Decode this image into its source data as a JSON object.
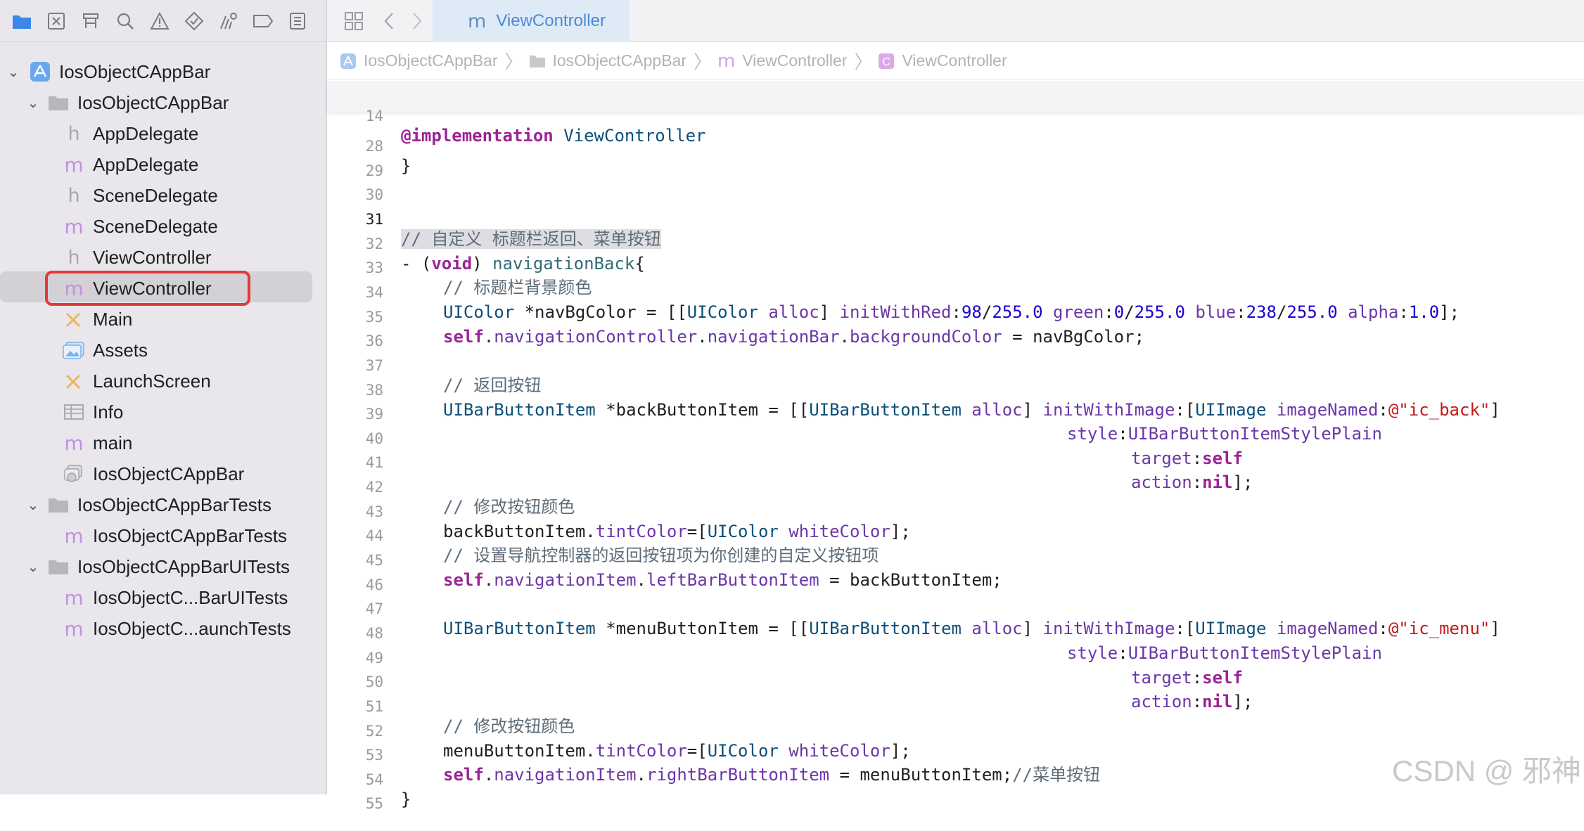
{
  "navigator": {
    "toolbar_icons": [
      "folder-icon",
      "source-control-icon",
      "symbol-icon",
      "find-icon",
      "issue-icon",
      "test-icon",
      "debug-icon",
      "breakpoint-icon",
      "report-icon"
    ],
    "items": [
      {
        "label": "IosObjectCAppBar",
        "icon": "project-icon",
        "level": 0,
        "disclosure": "open"
      },
      {
        "label": "IosObjectCAppBar",
        "icon": "folder-icon",
        "level": 1,
        "disclosure": "open"
      },
      {
        "label": "AppDelegate",
        "icon": "h-file-icon",
        "level": 2
      },
      {
        "label": "AppDelegate",
        "icon": "m-file-icon",
        "level": 2
      },
      {
        "label": "SceneDelegate",
        "icon": "h-file-icon",
        "level": 2
      },
      {
        "label": "SceneDelegate",
        "icon": "m-file-icon",
        "level": 2
      },
      {
        "label": "ViewController",
        "icon": "h-file-icon",
        "level": 2
      },
      {
        "label": "ViewController",
        "icon": "m-file-icon",
        "level": 2,
        "selected": true
      },
      {
        "label": "Main",
        "icon": "storyboard-icon",
        "level": 2
      },
      {
        "label": "Assets",
        "icon": "assets-icon",
        "level": 2
      },
      {
        "label": "LaunchScreen",
        "icon": "storyboard-icon",
        "level": 2
      },
      {
        "label": "Info",
        "icon": "plist-icon",
        "level": 2
      },
      {
        "label": "main",
        "icon": "m-file-icon",
        "level": 2
      },
      {
        "label": "IosObjectCAppBar",
        "icon": "entitlements-icon",
        "level": 2
      },
      {
        "label": "IosObjectCAppBarTests",
        "icon": "folder-icon",
        "level": 1,
        "disclosure": "open"
      },
      {
        "label": "IosObjectCAppBarTests",
        "icon": "m-file-icon",
        "level": 2
      },
      {
        "label": "IosObjectCAppBarUITests",
        "icon": "folder-icon",
        "level": 1,
        "disclosure": "open"
      },
      {
        "label": "IosObjectC...BarUITests",
        "icon": "m-file-icon",
        "level": 2
      },
      {
        "label": "IosObjectC...aunchTests",
        "icon": "m-file-icon",
        "level": 2
      }
    ]
  },
  "tab": {
    "icon": "m",
    "label": "ViewController"
  },
  "breadcrumb": [
    {
      "label": "IosObjectCAppBar",
      "icon": "project-icon"
    },
    {
      "label": "IosObjectCAppBar",
      "icon": "folder-icon"
    },
    {
      "label": "ViewController",
      "icon": "m-file-icon"
    },
    {
      "label": "ViewController",
      "icon": "class-icon"
    }
  ],
  "sticky_header": {
    "line": "14",
    "keyword": "@implementation",
    "name": "ViewController"
  },
  "code": {
    "l28": {
      "n": "28",
      "t": "}"
    },
    "l29": {
      "n": "29"
    },
    "l30": {
      "n": "30"
    },
    "l31": {
      "n": "31",
      "comment": "// 自定义 标题栏返回、菜单按钮"
    },
    "l32": {
      "n": "32",
      "a": "- (",
      "kw": "void",
      "b": ") ",
      "fn": "navigationBack",
      "c": "{"
    },
    "l33": {
      "n": "33",
      "comment": "// 标题栏背景颜色"
    },
    "l34": {
      "n": "34",
      "cls": "UIColor",
      "a": " *navBgColor = [[",
      "cls2": "UIColor",
      "m1": " alloc",
      "b": "] ",
      "m2": "initWithRed",
      "c": ":",
      "n1": "98",
      "d": "/",
      "n2": "255.0",
      "m3": " green",
      "e": ":",
      "n3": "0",
      "f": "/",
      "n4": "255.0",
      "m4": " blue",
      "g": ":",
      "n5": "238",
      "h": "/",
      "n6": "255.0",
      "m5": " alpha",
      "i": ":",
      "n7": "1.0",
      "j": "];"
    },
    "l35": {
      "n": "35",
      "kw": "self",
      "a": ".",
      "p1": "navigationController",
      "b": ".",
      "p2": "navigationBar",
      "c": ".",
      "p3": "backgroundColor",
      "d": " = navBgColor;"
    },
    "l36": {
      "n": "36"
    },
    "l37": {
      "n": "37",
      "comment": "// 返回按钮"
    },
    "l38": {
      "n": "38",
      "cls": "UIBarButtonItem",
      "a": " *backButtonItem = [[",
      "cls2": "UIBarButtonItem",
      "m1": " alloc",
      "b": "] ",
      "m2": "initWithImage",
      "c": ":[",
      "cls3": "UIImage",
      "m3": " imageNamed",
      "d": ":",
      "str": "@\"ic_back\"",
      "e": "]"
    },
    "l39": {
      "n": "39",
      "m": "style",
      "a": ":",
      "v": "UIBarButtonItemStylePlain"
    },
    "l40": {
      "n": "40",
      "m": "target",
      "a": ":",
      "kw": "self"
    },
    "l41": {
      "n": "41",
      "m": "action",
      "a": ":",
      "kw": "nil",
      "b": "];"
    },
    "l42": {
      "n": "42",
      "comment": "// 修改按钮颜色"
    },
    "l43": {
      "n": "43",
      "a": "backButtonItem.",
      "p": "tintColor",
      "b": "=[",
      "cls": "UIColor",
      "m": " whiteColor",
      "c": "];"
    },
    "l44": {
      "n": "44",
      "comment": "// 设置导航控制器的返回按钮项为你创建的自定义按钮项"
    },
    "l45": {
      "n": "45",
      "kw": "self",
      "a": ".",
      "p1": "navigationItem",
      "b": ".",
      "p2": "leftBarButtonItem",
      "c": " = backButtonItem;"
    },
    "l46": {
      "n": "46"
    },
    "l47": {
      "n": "47",
      "cls": "UIBarButtonItem",
      "a": " *menuButtonItem = [[",
      "cls2": "UIBarButtonItem",
      "m1": " alloc",
      "b": "] ",
      "m2": "initWithImage",
      "c": ":[",
      "cls3": "UIImage",
      "m3": " imageNamed",
      "d": ":",
      "str": "@\"ic_menu\"",
      "e": "]"
    },
    "l48": {
      "n": "48",
      "m": "style",
      "a": ":",
      "v": "UIBarButtonItemStylePlain"
    },
    "l49": {
      "n": "49",
      "m": "target",
      "a": ":",
      "kw": "self"
    },
    "l50": {
      "n": "50",
      "m": "action",
      "a": ":",
      "kw": "nil",
      "b": "];"
    },
    "l51": {
      "n": "51",
      "comment": "// 修改按钮颜色"
    },
    "l52": {
      "n": "52",
      "a": "menuButtonItem.",
      "p": "tintColor",
      "b": "=[",
      "cls": "UIColor",
      "m": " whiteColor",
      "c": "];"
    },
    "l53": {
      "n": "53",
      "kw": "self",
      "a": ".",
      "p1": "navigationItem",
      "b": ".",
      "p2": "rightBarButtonItem",
      "c": " = menuButtonItem;",
      "comment": "//菜单按钮"
    },
    "l54": {
      "n": "54",
      "t": "}"
    },
    "l55": {
      "n": "55"
    }
  },
  "watermark": "CSDN @  邪神",
  "colors": {
    "selection_border": "#e53935",
    "tab_active_bg": "#dfeaf7",
    "keyword": "#9b2393",
    "class": "#0b4f79",
    "method": "#6c36a9",
    "number": "#1c00cf",
    "string": "#c41a16",
    "comment": "#5d6c79"
  }
}
